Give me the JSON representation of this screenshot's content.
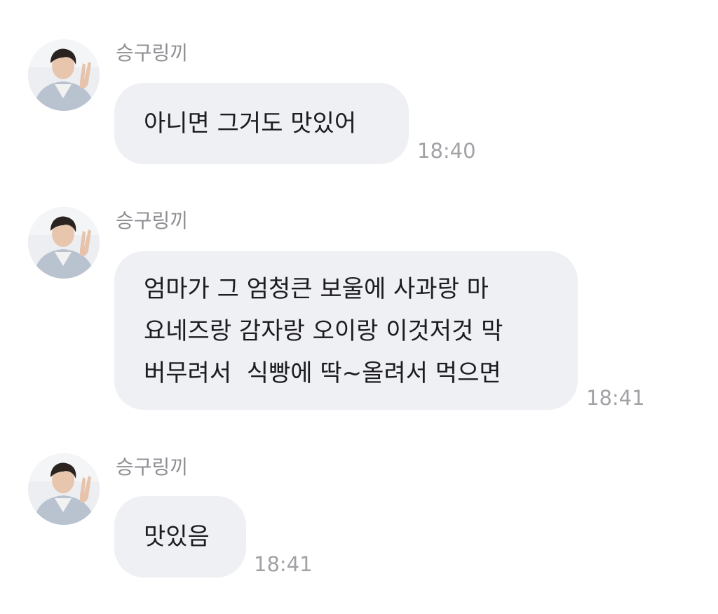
{
  "chat": {
    "messages": [
      {
        "sender": "승구링끼",
        "text": "아니면 그거도 맛있어",
        "time": "18:40"
      },
      {
        "sender": "승구링끼",
        "text": "엄마가 그 엄청큰 보울에 사과랑 마\n요네즈랑 감자랑 오이랑 이것저것 막\n버무려서  식빵에 딱~올려서 먹으면",
        "time": "18:41"
      },
      {
        "sender": "승구링끼",
        "text": "맛있음",
        "time": "18:41"
      }
    ]
  },
  "colors": {
    "bubble_bg": "#eff0f4",
    "sender_text": "#8e8e93",
    "time_text": "#a1a1a6"
  },
  "icons": {
    "avatar": "profile-photo-peace-sign"
  }
}
